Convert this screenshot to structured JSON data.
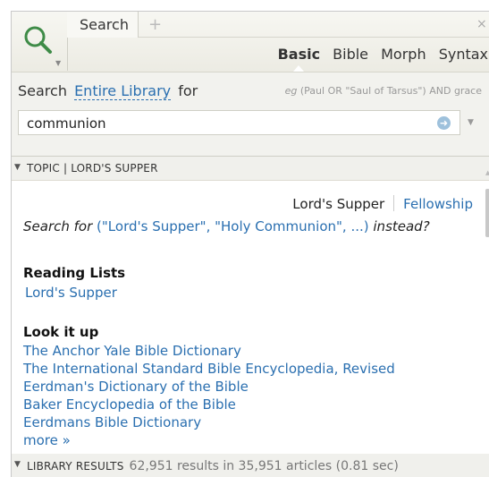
{
  "header": {
    "tab_label": "Search",
    "add_tab": "+",
    "close": "×",
    "modes": [
      "Basic",
      "Bible",
      "Morph",
      "Syntax"
    ],
    "active_mode": "Basic"
  },
  "options": {
    "search_word": "Search",
    "scope": "Entire Library",
    "for_word": "for",
    "example_prefix": "eg",
    "example": "(Paul OR \"Saul of Tarsus\") AND grace",
    "query": "communion"
  },
  "topic_section": {
    "title": "TOPIC | LORD'S SUPPER",
    "topics": [
      "Lord's Supper",
      "Fellowship"
    ],
    "suggest_prefix": "Search for",
    "suggest_link": "(\"Lord's Supper\", \"Holy Communion\", ...)",
    "suggest_suffix": "instead?",
    "reading_lists_heading": "Reading Lists",
    "reading_lists": [
      "Lord's Supper"
    ],
    "lookup_heading": "Look it up",
    "lookup": [
      "The Anchor Yale Bible Dictionary",
      "The International Standard Bible Encyclopedia, Revised",
      "Eerdman's Dictionary of the Bible",
      "Baker Encyclopedia of the Bible",
      "Eerdmans Bible Dictionary"
    ],
    "more": "more »"
  },
  "library_section": {
    "title": "LIBRARY RESULTS",
    "meta": "62,951 results in 35,951 articles (0.81 sec)"
  },
  "colors": {
    "link": "#2a6fb0",
    "header_bg": "#ecebe3"
  }
}
